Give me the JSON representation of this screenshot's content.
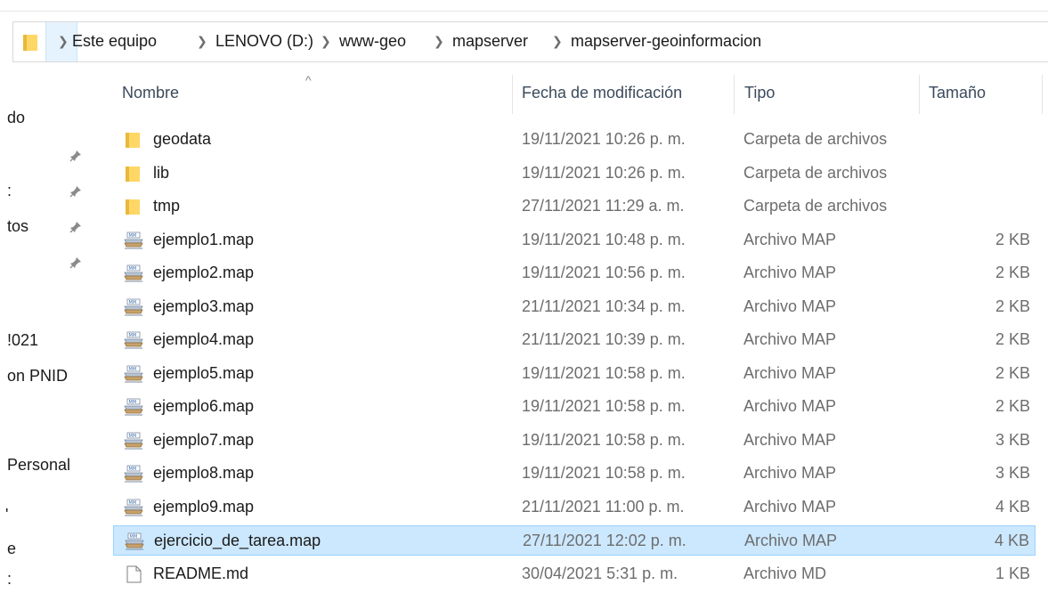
{
  "breadcrumb": [
    "Este equipo",
    "LENOVO (D:)",
    "www-geo",
    "mapserver",
    "mapserver-geoinformacion"
  ],
  "nav": {
    "items": [
      {
        "label": "do",
        "pinned": false
      },
      {
        "label": "",
        "pinned": true
      },
      {
        "label": ":",
        "pinned": true
      },
      {
        "label": "tos",
        "pinned": true
      },
      {
        "label": "",
        "pinned": true
      },
      {
        "label": "!021",
        "pinned": false
      },
      {
        "label": "on PNID",
        "pinned": false
      },
      {
        "label": "Personal",
        "pinned": false
      },
      {
        "label": "'",
        "pinned": false
      },
      {
        "label": "e",
        "pinned": false
      },
      {
        "label": ":",
        "pinned": false
      }
    ]
  },
  "columns": {
    "name": "Nombre",
    "date": "Fecha de modificación",
    "type": "Tipo",
    "size": "Tamaño",
    "sort_indicator": "^"
  },
  "files": [
    {
      "name": "geodata",
      "date": "19/11/2021 10:26 p. m.",
      "type": "Carpeta de archivos",
      "size": "",
      "icon": "folder-icon"
    },
    {
      "name": "lib",
      "date": "19/11/2021 10:26 p. m.",
      "type": "Carpeta de archivos",
      "size": "",
      "icon": "folder-icon"
    },
    {
      "name": "tmp",
      "date": "27/11/2021 11:29 a. m.",
      "type": "Carpeta de archivos",
      "size": "",
      "icon": "folder-icon"
    },
    {
      "name": "ejemplo1.map",
      "date": "19/11/2021 10:48 p. m.",
      "type": "Archivo MAP",
      "size": "2 KB",
      "icon": "map-file-icon"
    },
    {
      "name": "ejemplo2.map",
      "date": "19/11/2021 10:56 p. m.",
      "type": "Archivo MAP",
      "size": "2 KB",
      "icon": "map-file-icon"
    },
    {
      "name": "ejemplo3.map",
      "date": "21/11/2021 10:34 p. m.",
      "type": "Archivo MAP",
      "size": "2 KB",
      "icon": "map-file-icon"
    },
    {
      "name": "ejemplo4.map",
      "date": "21/11/2021 10:39 p. m.",
      "type": "Archivo MAP",
      "size": "2 KB",
      "icon": "map-file-icon"
    },
    {
      "name": "ejemplo5.map",
      "date": "19/11/2021 10:58 p. m.",
      "type": "Archivo MAP",
      "size": "2 KB",
      "icon": "map-file-icon"
    },
    {
      "name": "ejemplo6.map",
      "date": "19/11/2021 10:58 p. m.",
      "type": "Archivo MAP",
      "size": "2 KB",
      "icon": "map-file-icon"
    },
    {
      "name": "ejemplo7.map",
      "date": "19/11/2021 10:58 p. m.",
      "type": "Archivo MAP",
      "size": "3 KB",
      "icon": "map-file-icon"
    },
    {
      "name": "ejemplo8.map",
      "date": "19/11/2021 10:58 p. m.",
      "type": "Archivo MAP",
      "size": "3 KB",
      "icon": "map-file-icon"
    },
    {
      "name": "ejemplo9.map",
      "date": "21/11/2021 11:00 p. m.",
      "type": "Archivo MAP",
      "size": "4 KB",
      "icon": "map-file-icon"
    },
    {
      "name": "ejercicio_de_tarea.map",
      "date": "27/11/2021 12:02 p. m.",
      "type": "Archivo MAP",
      "size": "4 KB",
      "icon": "map-file-icon",
      "selected": true
    },
    {
      "name": "README.md",
      "date": "30/04/2021 5:31 p. m.",
      "type": "Archivo MD",
      "size": "1 KB",
      "icon": "document-file-icon"
    }
  ],
  "colors": {
    "selection_bg": "#cce8ff",
    "selection_border": "#99d1ff",
    "folder_yellow": "#ffd766",
    "secondary_text": "#6d6d6d"
  }
}
